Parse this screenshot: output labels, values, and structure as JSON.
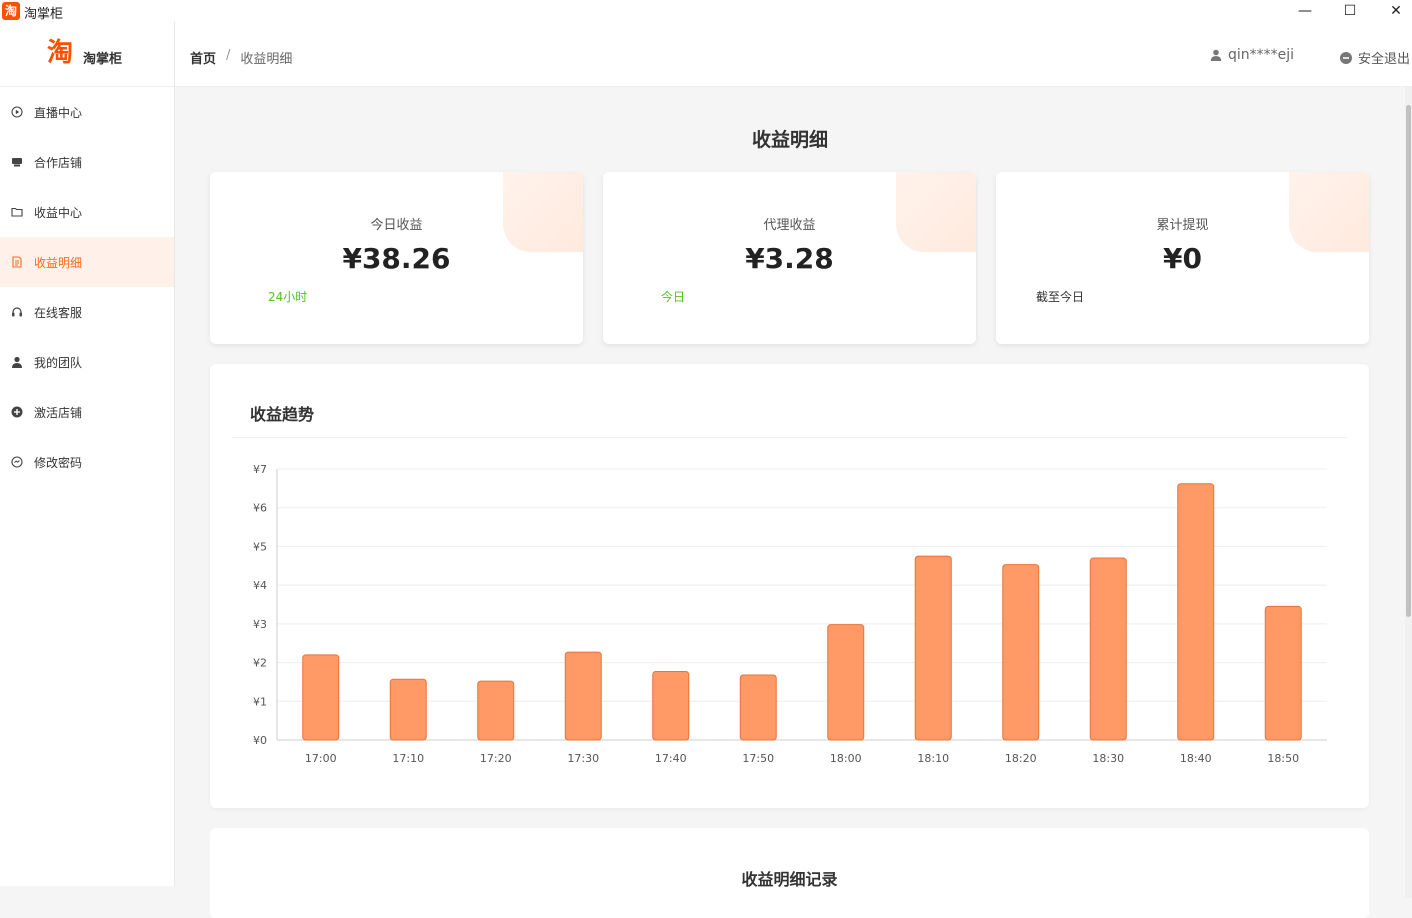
{
  "window": {
    "title": "淘掌柜",
    "icon_char": "淘",
    "controls": {
      "minimize": "—",
      "maximize": "☐",
      "close": "✕"
    }
  },
  "sidebar": {
    "brand": {
      "logo_char": "淘",
      "name": "淘掌柜"
    },
    "items": [
      {
        "label": "直播中心",
        "icon": "play-circle-icon",
        "active": false
      },
      {
        "label": "合作店铺",
        "icon": "shop-icon",
        "active": false
      },
      {
        "label": "收益中心",
        "icon": "folder-icon",
        "active": false
      },
      {
        "label": "收益明细",
        "icon": "document-icon",
        "active": true
      },
      {
        "label": "在线客服",
        "icon": "headset-icon",
        "active": false
      },
      {
        "label": "我的团队",
        "icon": "user-icon",
        "active": false
      },
      {
        "label": "激活店铺",
        "icon": "plus-circle-icon",
        "active": false
      },
      {
        "label": "修改密码",
        "icon": "key-circle-icon",
        "active": false
      }
    ]
  },
  "header": {
    "breadcrumb": {
      "home": "首页",
      "separator": "/",
      "current": "收益明细"
    },
    "username": "qin****eji",
    "logout": "安全退出"
  },
  "main": {
    "title": "收益明细",
    "cards": [
      {
        "label": "今日收益",
        "value": "¥38.26",
        "note": "24小时",
        "note_color": "#52c41a"
      },
      {
        "label": "代理收益",
        "value": "¥3.28",
        "note": "今日",
        "note_color": "#52c41a"
      },
      {
        "label": "累计提现",
        "value": "¥0",
        "note": "截至今日",
        "note_color": "#333333"
      }
    ],
    "chart_title": "收益趋势",
    "records_title": "收益明细记录"
  },
  "colors": {
    "accent": "#ff6a1a",
    "bar": "#ff9966",
    "bar_stroke": "#e8733a",
    "active_bg": "#fff1ea"
  },
  "chart_data": {
    "type": "bar",
    "title": "收益趋势",
    "categories": [
      "17:00",
      "17:10",
      "17:20",
      "17:30",
      "17:40",
      "17:50",
      "18:00",
      "18:10",
      "18:20",
      "18:30",
      "18:40",
      "18:50"
    ],
    "values": [
      2.2,
      1.57,
      1.52,
      2.27,
      1.77,
      1.68,
      2.98,
      4.75,
      4.53,
      4.7,
      6.62,
      3.45
    ],
    "y_ticks": [
      "¥0",
      "¥1",
      "¥2",
      "¥3",
      "¥4",
      "¥5",
      "¥6",
      "¥7"
    ],
    "ylim": [
      0,
      7
    ],
    "grid": true,
    "xlabel": "",
    "ylabel": ""
  }
}
